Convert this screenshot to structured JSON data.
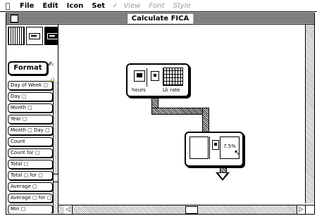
{
  "menubar": {
    "apple": "",
    "items": [
      "File",
      "Edit",
      "Icon",
      "Set"
    ],
    "check": "✓",
    "dimmed": [
      "View",
      "Font",
      "Style"
    ]
  },
  "window": {
    "title": "Calculate FICA"
  },
  "palette": {
    "format_label": "Format",
    "items": [
      "Day of Week ▢",
      "Day ▢",
      "Month ▢",
      "Year ▢",
      "Month ▢ Day ▢",
      "Count",
      "Count for ▢",
      "Total ▢",
      "Total ▢ for ▢",
      "Average ▢",
      "Average ▢ for ▢",
      "Min ▢"
    ]
  },
  "canvas": {
    "hours_node": {
      "left_label": "hours",
      "right_label": "Lk rate"
    },
    "rate_node": {
      "value": "7.5%"
    }
  },
  "icons": {
    "format": "✍",
    "lock": "🔒",
    "cursor": "↖",
    "left_arrow": "◁",
    "right_arrow": "▷"
  }
}
